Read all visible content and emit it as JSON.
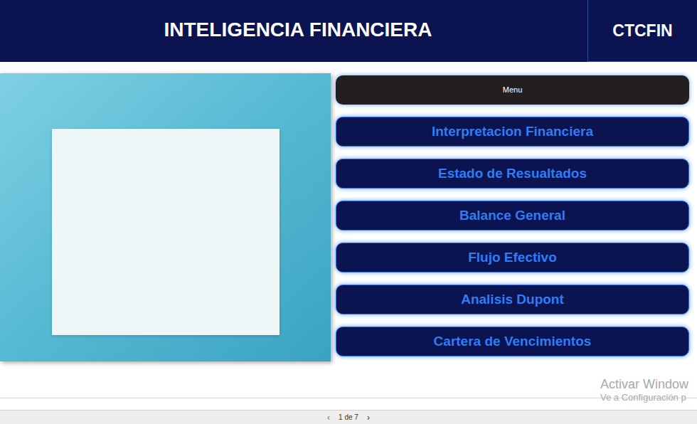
{
  "header": {
    "title": "INTELIGENCIA FINANCIERA",
    "brand": "CTCFIN"
  },
  "menu": {
    "title": "Menu",
    "items": [
      {
        "label": "Interpretacion Financiera"
      },
      {
        "label": "Estado de Resualtados"
      },
      {
        "label": "Balance General"
      },
      {
        "label": "Flujo Efectivo"
      },
      {
        "label": "Analisis Dupont"
      },
      {
        "label": "Cartera de Vencimientos"
      }
    ]
  },
  "watermark": {
    "line1": "Activar Window",
    "line2": "Ve a Configuración p"
  },
  "pager": {
    "prev": "‹",
    "label": "1 de 7",
    "next": "›"
  }
}
